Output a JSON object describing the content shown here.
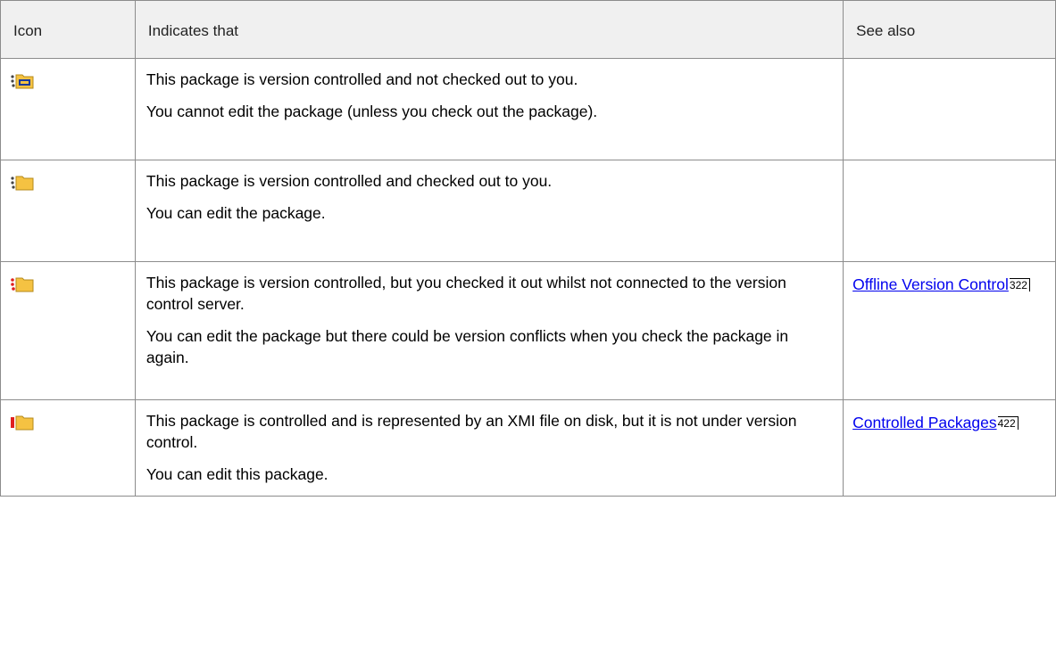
{
  "table": {
    "headers": {
      "icon": "Icon",
      "indicates": "Indicates that",
      "see_also": "See also"
    },
    "rows": [
      {
        "icon": "package-checked-in-locked-icon",
        "lines": [
          "This package is version controlled and not checked out to you.",
          "You cannot edit the package (unless you check out the package)."
        ],
        "see_also": "",
        "page": ""
      },
      {
        "icon": "package-checked-out-icon",
        "lines": [
          "This package is version controlled and checked out to you.",
          "You can edit the package."
        ],
        "see_also": "",
        "page": ""
      },
      {
        "icon": "package-offline-checked-out-icon",
        "lines": [
          "This package is version controlled, but you checked it out whilst not connected to the version control server.",
          "You can edit the package but there could be version conflicts when you check the package in again."
        ],
        "see_also": "Offline Version Control",
        "page": "322"
      },
      {
        "icon": "package-controlled-xmi-icon",
        "lines": [
          "This package is controlled and is represented by an XMI file on disk, but it is not under version control.",
          "You can edit this package."
        ],
        "see_also": "Controlled Packages",
        "page": "422"
      }
    ]
  },
  "colors": {
    "folder": "#f5c242",
    "folder_dark": "#b58a1a",
    "red_marker": "#e02020",
    "lock_blue": "#1a3a9a"
  }
}
